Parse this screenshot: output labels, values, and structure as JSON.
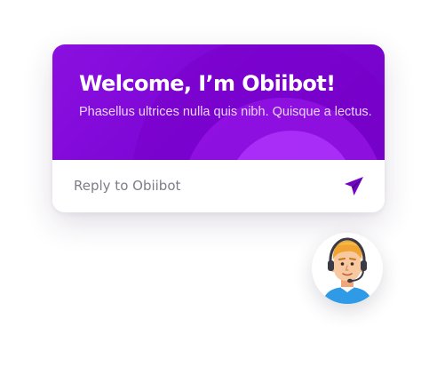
{
  "chat_widget": {
    "title": "Welcome, I’m Obiibot!",
    "subtitle": "Phasellus ultrices nulla quis nibh. Quisque a lectus.",
    "reply_placeholder": "Reply to Obiibot",
    "send_icon": "paper-plane-icon",
    "avatar_icon": "support-agent-headset-avatar"
  },
  "colors": {
    "header_primary": "#7c05d4",
    "header_accent": "#b237ff",
    "send_icon": "#7403c6",
    "avatar_shirt": "#2f9be6"
  }
}
